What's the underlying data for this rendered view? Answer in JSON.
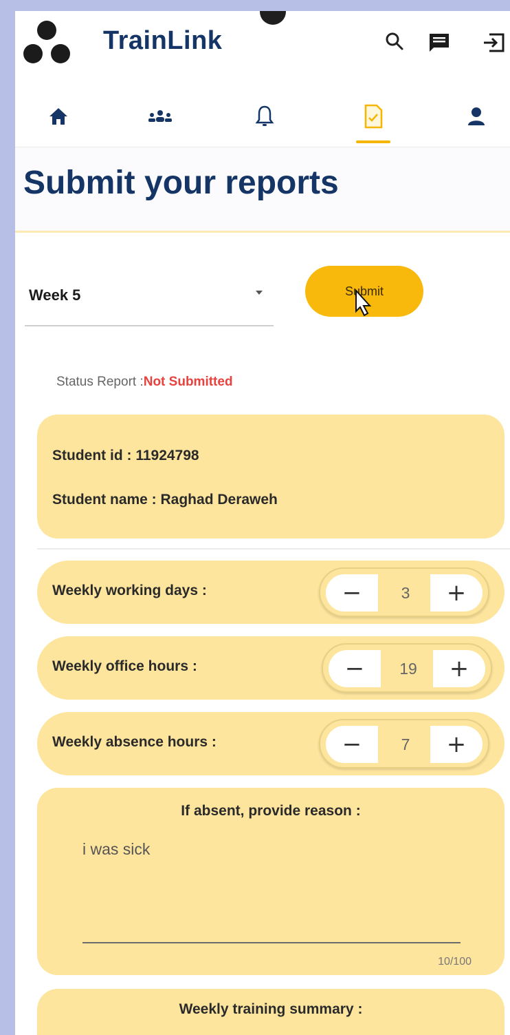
{
  "app": {
    "title": "TrainLink"
  },
  "colors": {
    "primary": "#143565",
    "accent": "#f8b90c",
    "card": "#fde59e",
    "danger": "#e8423e"
  },
  "topbar_icons": [
    "search-icon",
    "chat-icon",
    "logout-icon"
  ],
  "nav": {
    "items": [
      "home-icon",
      "groups-icon",
      "bell-icon",
      "report-icon",
      "profile-icon"
    ],
    "active": "report-icon"
  },
  "page": {
    "title": "Submit your reports"
  },
  "week_select": {
    "value": "Week 5"
  },
  "submit": {
    "label": "Submit"
  },
  "status": {
    "label": "Status Report :",
    "value": "Not Submitted"
  },
  "student": {
    "id_line": "Student id : 11924798",
    "name_line": "Student name : Raghad Deraweh"
  },
  "counters": [
    {
      "label": "Weekly working days :",
      "value": "3",
      "minus": "−",
      "plus": "+"
    },
    {
      "label": "Weekly office hours :",
      "value": "19",
      "minus": "−",
      "plus": "+"
    },
    {
      "label": "Weekly absence hours :",
      "value": "7",
      "minus": "−",
      "plus": "+"
    }
  ],
  "reason": {
    "title": "If absent, provide reason :",
    "text": "i was sick",
    "counter": "10/100"
  },
  "summary": {
    "title": "Weekly training summary :"
  }
}
